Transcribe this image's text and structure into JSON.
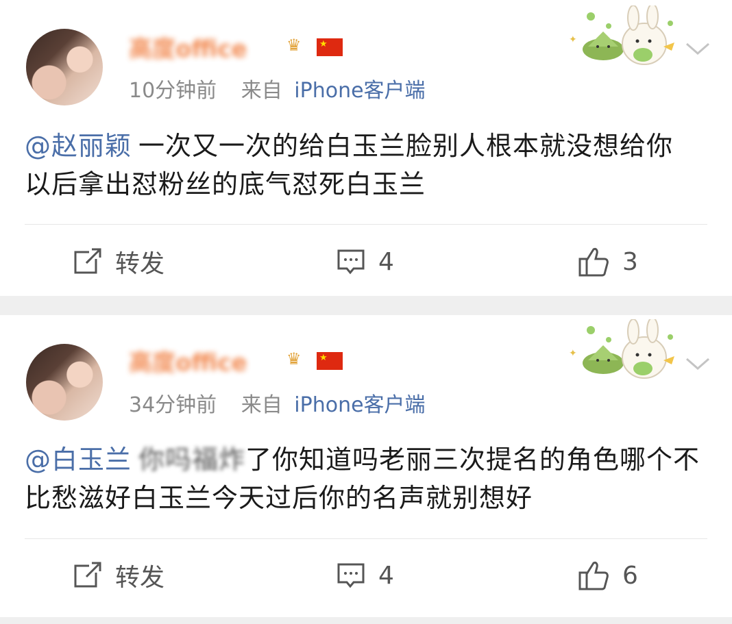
{
  "posts": [
    {
      "username": "高度office",
      "time": "10分钟前",
      "source_prefix": "来自",
      "source_client": "iPhone客户端",
      "mention": "@赵丽颖",
      "text": "一次又一次的给白玉兰脸别人根本就没想给你 以后拿出怼粉丝的底气怼死白玉兰",
      "actions": {
        "repost_label": "转发",
        "comment_count": "4",
        "like_count": "3"
      }
    },
    {
      "username": "高度office",
      "time": "34分钟前",
      "source_prefix": "来自",
      "source_client": "iPhone客户端",
      "mention": "@白玉兰",
      "text_blurred": "你吗福炸",
      "text": "了你知道吗老丽三次提名的角色哪个不比愁滋好白玉兰今天过后你的名声就别想好",
      "actions": {
        "repost_label": "转发",
        "comment_count": "4",
        "like_count": "6"
      }
    }
  ],
  "icons": {
    "repost": "edit-share-icon",
    "comment": "comment-bubble-icon",
    "like": "thumbs-up-icon",
    "more": "chevron-down-icon",
    "flag": "china-flag-icon",
    "badge": "crown-badge-icon",
    "sticker": "bunny-zongzi-sticker"
  },
  "colors": {
    "mention": "#4a6ea8",
    "username": "#f07a3a",
    "meta": "#8a8a8a",
    "separator": "#efefef"
  }
}
